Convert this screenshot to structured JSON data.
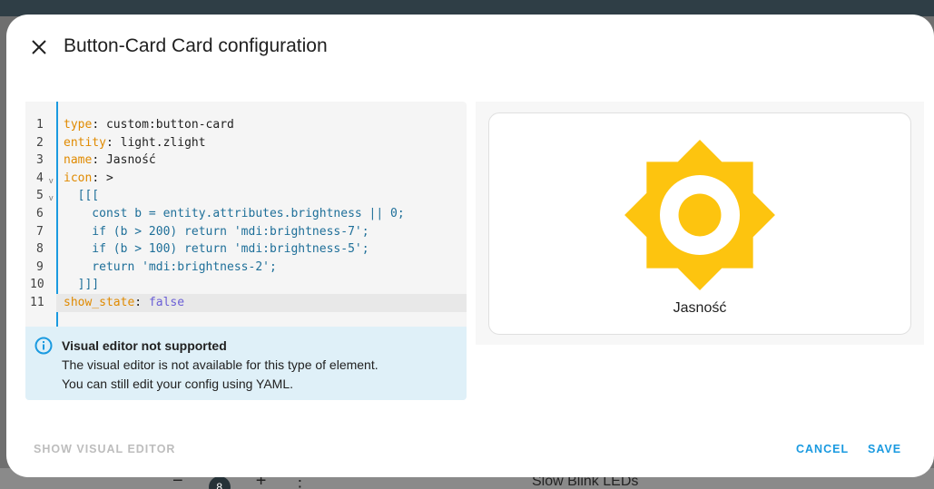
{
  "colors": {
    "accent": "#1a9ae0",
    "icon_yellow": "#fdc40f",
    "alert_bg": "#dff0f8",
    "yaml_key": "#e08a00",
    "yaml_value": "#1e6f99",
    "yaml_false": "#6b5fd6"
  },
  "background": {
    "badge_count": "8",
    "minus_label": "−",
    "plus_label": "+",
    "more_label": "⋮",
    "slow_blink_label": "Slow Blink LEDs"
  },
  "dialog": {
    "close_icon": "close-icon",
    "title": "Button-Card Card configuration"
  },
  "editor": {
    "line_numbers": [
      "1",
      "2",
      "3",
      "4",
      "5",
      "6",
      "7",
      "8",
      "9",
      "10",
      "11"
    ],
    "lines": {
      "l1_key": "type",
      "l1_sep": ": ",
      "l1_val": "custom:button-card",
      "l2_key": "entity",
      "l2_sep": ": ",
      "l2_val": "light.zlight",
      "l3_key": "name",
      "l3_sep": ": ",
      "l3_val": "Jasność",
      "l4_key": "icon",
      "l4_sep": ": ",
      "l4_val": ">",
      "l5": "  [[[",
      "l6": "    const b = entity.attributes.brightness || 0;",
      "l7": "    if (b > 200) return 'mdi:brightness-7';",
      "l8": "    if (b > 100) return 'mdi:brightness-5';",
      "l9": "    return 'mdi:brightness-2';",
      "l10": "  ]]]",
      "l11_key": "show_state",
      "l11_sep": ": ",
      "l11_val": "false"
    }
  },
  "alert": {
    "icon": "info-icon",
    "title": "Visual editor not supported",
    "line1": "The visual editor is not available for this type of element.",
    "line2": "You can still edit your config using YAML."
  },
  "preview": {
    "icon": "brightness-icon",
    "name": "Jasność"
  },
  "footer": {
    "show_visual_editor": "SHOW VISUAL EDITOR",
    "cancel": "CANCEL",
    "save": "SAVE"
  }
}
